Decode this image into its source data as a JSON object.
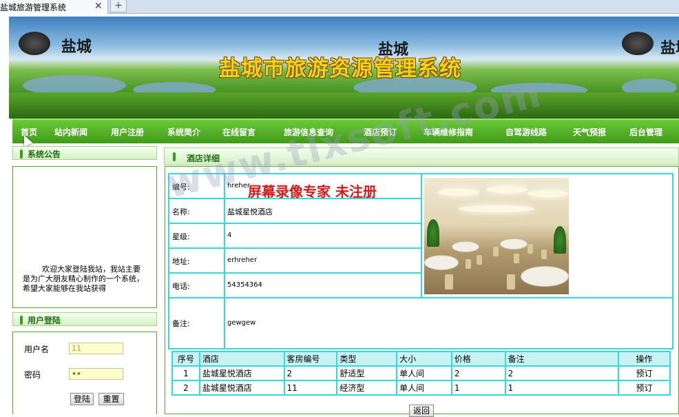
{
  "browser": {
    "tab_title": "盐城旅游管理系统",
    "close_glyph": "✕",
    "new_tab_glyph": "+"
  },
  "banner": {
    "title": "盐城市旅游资源管理系统",
    "logo_text": "盐城"
  },
  "nav": {
    "items": [
      "首页",
      "站内新闻",
      "用户注册",
      "系统简介",
      "在线留言",
      "旅游信息查询",
      "酒店预订",
      "车辆维修指南",
      "自驾游线路",
      "天气预报",
      "后台管理"
    ]
  },
  "sidebar": {
    "notice_title": "系统公告",
    "notice_text": "欢迎大家登陆我站，我站主要是为广大朋友精心制作的一个系统，希望大家能够在我站获得",
    "login_title": "用户登陆",
    "username_label": "用户名",
    "username_value": "11",
    "password_label": "密码",
    "password_value": "••",
    "login_button": "登陆",
    "reset_button": "重置"
  },
  "detail": {
    "title": "酒店详细",
    "fields": {
      "code_label": "编号:",
      "code_value": "hreher",
      "name_label": "名称:",
      "name_value": "盐城星悦酒店",
      "star_label": "星级:",
      "star_value": "4",
      "address_label": "地址:",
      "address_value": "erhreher",
      "phone_label": "电话:",
      "phone_value": "54354364",
      "remark_label": "备注:",
      "remark_value": "gewgew"
    },
    "rooms": {
      "headers": [
        "序号",
        "酒店",
        "客房编号",
        "类型",
        "大小",
        "价格",
        "备注",
        "操作"
      ],
      "rows": [
        [
          "1",
          "盐城星悦酒店",
          "2",
          "舒适型",
          "单人间",
          "2",
          "2",
          "预订"
        ],
        [
          "2",
          "盐城星悦酒店",
          "11",
          "经济型",
          "单人间",
          "1",
          "1",
          "预订"
        ]
      ]
    },
    "back_button": "返回"
  },
  "watermark": {
    "line1": "屏幕录像专家 未注册",
    "line2": "www.tlxsoft.com"
  },
  "colors": {
    "nav_green": "#4fab22",
    "cell_border": "#33dada",
    "header_cyan": "#c8f2f4",
    "title_gold": "#f3d21a"
  }
}
